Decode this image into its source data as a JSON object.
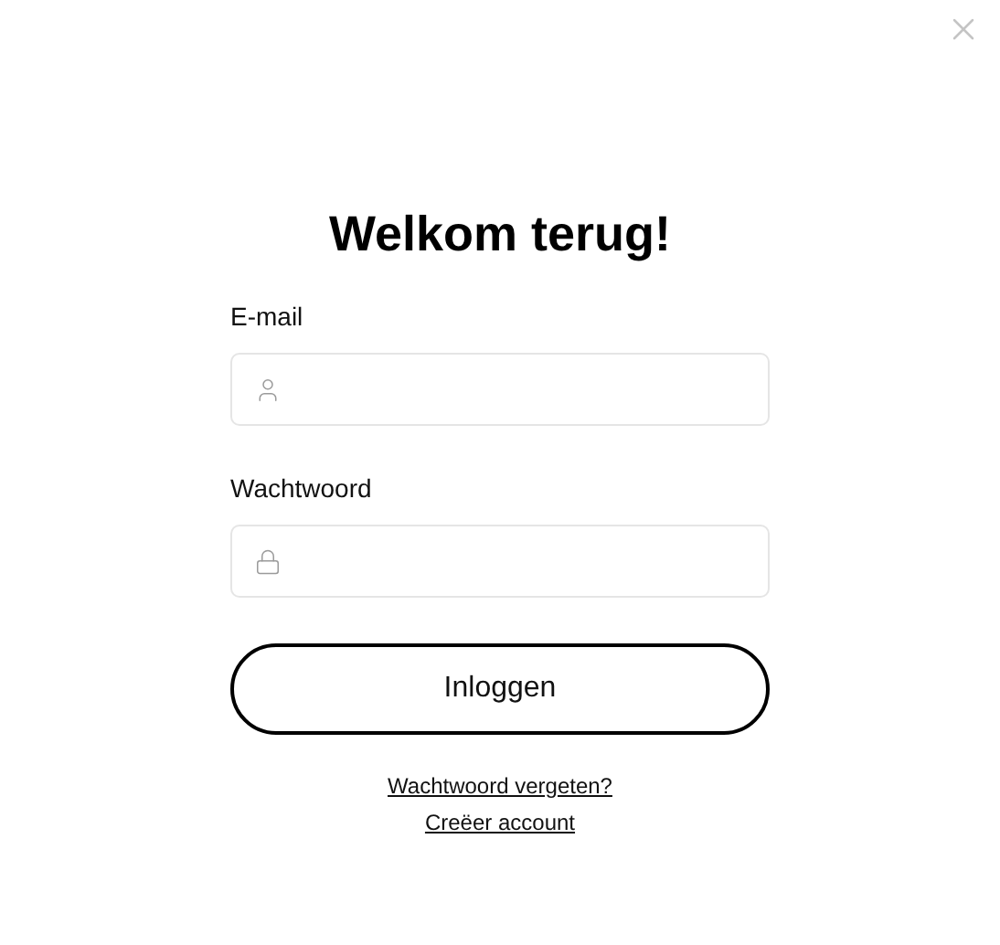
{
  "title": "Welkom terug!",
  "fields": [
    {
      "label": "E-mail",
      "kind": "user"
    },
    {
      "label": "Wachtwoord",
      "kind": "lock"
    }
  ],
  "submit": "Inloggen",
  "links": [
    "Wachtwoord vergeten?",
    "Creëer account"
  ]
}
